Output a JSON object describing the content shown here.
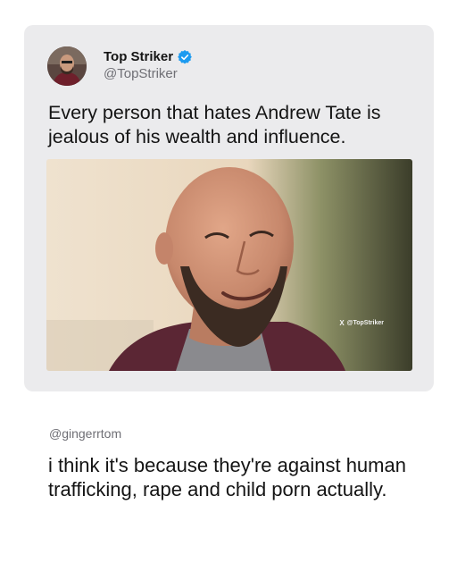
{
  "tweet": {
    "display_name": "Top Striker",
    "handle": "@TopStriker",
    "text": "Every person that hates Andrew Tate is jealous of his wealth and influence.",
    "media": {
      "watermark_logo": "X",
      "watermark_text": "@TopStriker"
    }
  },
  "reply": {
    "handle": "@gingerrtom",
    "text": "i think it's because they're against human trafficking, rape and child porn actually."
  },
  "icons": {
    "verified": "verified-badge-icon",
    "x_logo": "x-logo-icon"
  },
  "colors": {
    "card_background": "#ebebed",
    "verified_blue": "#1d9bf0",
    "secondary_text": "#6f6f75",
    "primary_text": "#141414"
  }
}
